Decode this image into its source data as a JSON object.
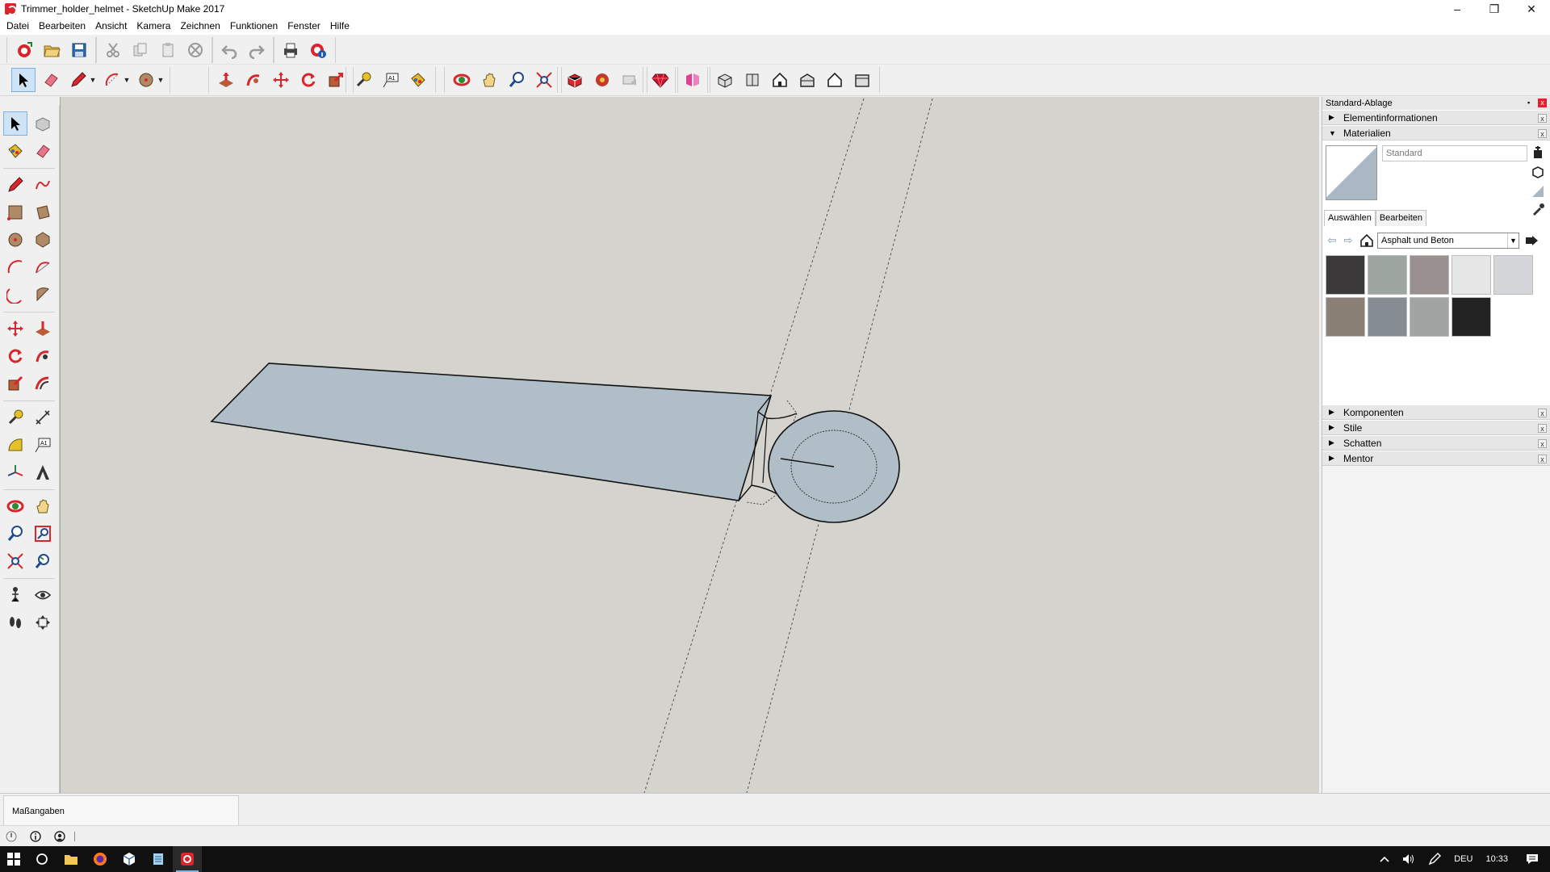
{
  "window": {
    "title": "Trimmer_holder_helmet - SketchUp Make 2017",
    "minimize": "–",
    "restore": "❐",
    "close": "✕"
  },
  "menu": [
    "Datei",
    "Bearbeiten",
    "Ansicht",
    "Kamera",
    "Zeichnen",
    "Funktionen",
    "Fenster",
    "Hilfe"
  ],
  "tray": {
    "title": "Standard-Ablage",
    "pin": "▪",
    "close": "x",
    "panels": {
      "entity_info": "Elementinformationen",
      "materials": "Materialien",
      "components": "Komponenten",
      "styles": "Stile",
      "shadows": "Schatten",
      "mentor": "Mentor"
    },
    "collapsed_marker": "▶",
    "expanded_marker": "▼",
    "materials": {
      "name_value": "Standard",
      "tab_select": "Auswählen",
      "tab_edit": "Bearbeiten",
      "library": "Asphalt und Beton",
      "dropdown_marker": "▼",
      "nav_back": "⇦",
      "nav_forward": "⇨",
      "swatch_colors": [
        "#3c393b",
        "#9ea6a2",
        "#9a9090",
        "#e6e6e6",
        "#d4d6da",
        "#8a8076",
        "#858d92",
        "#a2a4a3",
        "#222222"
      ]
    }
  },
  "measurements": {
    "label": "Maßangaben"
  },
  "taskbar": {
    "language": "DEU",
    "time": "10:33"
  },
  "colors": {
    "viewport_bg": "#d4d3ce",
    "face_fill": "#b0bec7",
    "brand_red": "#d8262c"
  }
}
